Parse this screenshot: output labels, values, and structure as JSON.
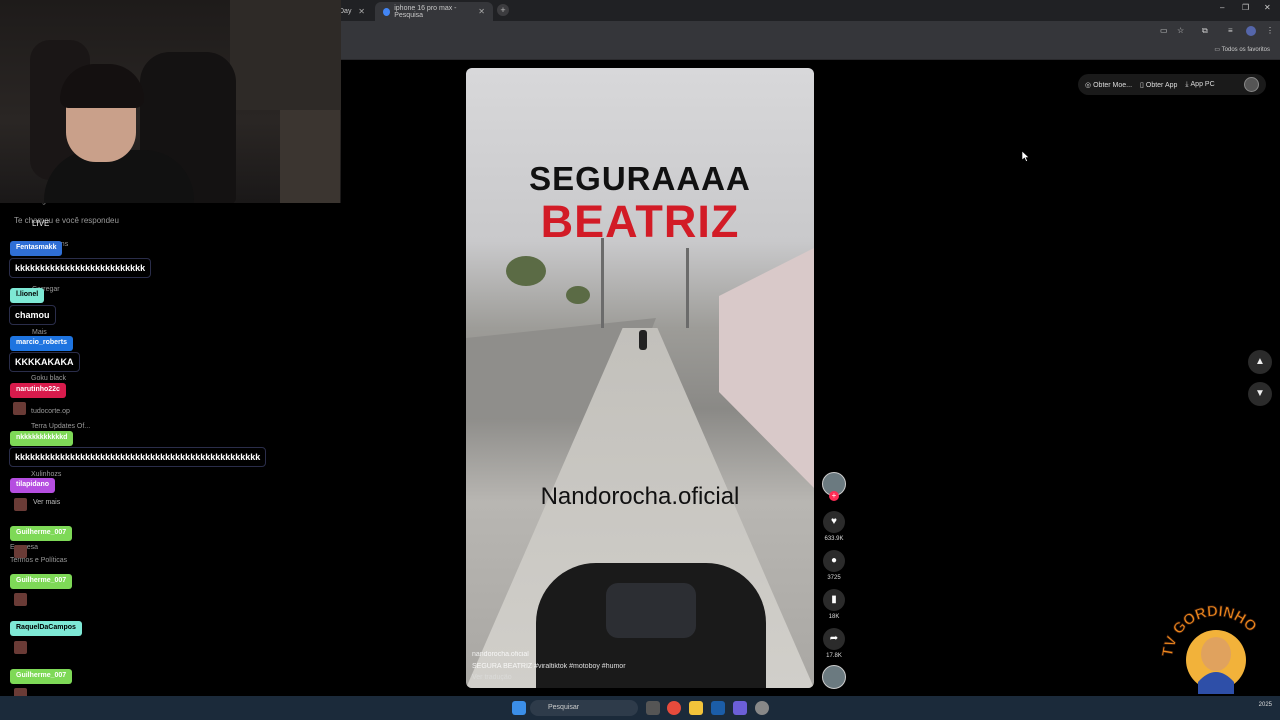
{
  "browser": {
    "tabs": [
      {
        "title": "Day",
        "close": "✕"
      },
      {
        "title": "iphone 16 pro max - Pesquisa",
        "close": "✕"
      }
    ],
    "new_tab": "+",
    "window_controls": [
      "–",
      "❐",
      "✕"
    ],
    "bookmarks_all": "Todos os favoritos"
  },
  "tiktok": {
    "top_buttons": [
      {
        "icon": "coin-icon",
        "label": "Obter Moe..."
      },
      {
        "icon": "phone-icon",
        "label": "Obter App"
      },
      {
        "icon": "download-icon",
        "label": "App PC"
      }
    ],
    "video": {
      "caption_line1": "SEGURAAAA",
      "caption_line2": "BEATRIZ",
      "watermark": "Nandorocha.oficial",
      "username": "nandorocha.oficial",
      "description": "SEGURA BEATRIZ  #viraltiktok  #motoboy  #humor",
      "translation": "Ver tradução"
    },
    "actions": {
      "likes": "633.9K",
      "comments": "3725",
      "saves": "18K",
      "shares": "17.8K"
    }
  },
  "sidebar_behind": {
    "items": [
      "Amigos",
      "LIVE",
      "Mensagens",
      "Carregar",
      "Mais",
      "Goku black",
      "tudocorte.op",
      "Terra Updates Of...",
      "Xulinhozs",
      "Ver mais",
      "Empresa",
      "Termos e Políticas"
    ],
    "notice": "Te chamou e você respondeu"
  },
  "chat": [
    {
      "user": "Fentasmakk",
      "color": "#2f6fd6",
      "message": "kkkkkkkkkkkkkkkkkkkkkkkkkk"
    },
    {
      "user": "l.lionel",
      "color": "#7ee8d5",
      "message": "chamou"
    },
    {
      "user": "marcio_roberts",
      "color": "#1e74e0",
      "message": "KKKKAKAKA"
    },
    {
      "user": "narutinho22c",
      "color": "#d81b4c",
      "message": ""
    },
    {
      "user": "nkkkkkkkkkkkd",
      "color": "#7ed957",
      "message": "kkkkkkkkkkkkkkkkkkkkkkkkkkkkkkkkkkkkkkkkkkkkkkkkk"
    },
    {
      "user": "tilapidano",
      "color": "#b54ee0",
      "message": ""
    },
    {
      "user": "Guilherme_007",
      "color": "#7ed957",
      "message": ""
    },
    {
      "user": "Guilherme_007",
      "color": "#7ed957",
      "message": ""
    },
    {
      "user": "RaquelDaCampos",
      "color": "#7ee8d5",
      "message": ""
    },
    {
      "user": "Guilherme_007",
      "color": "#7ed957",
      "message": ""
    }
  ],
  "overlay_logo": "TV GORDINHO",
  "taskbar": {
    "search_placeholder": "Pesquisar",
    "date": "2025"
  }
}
